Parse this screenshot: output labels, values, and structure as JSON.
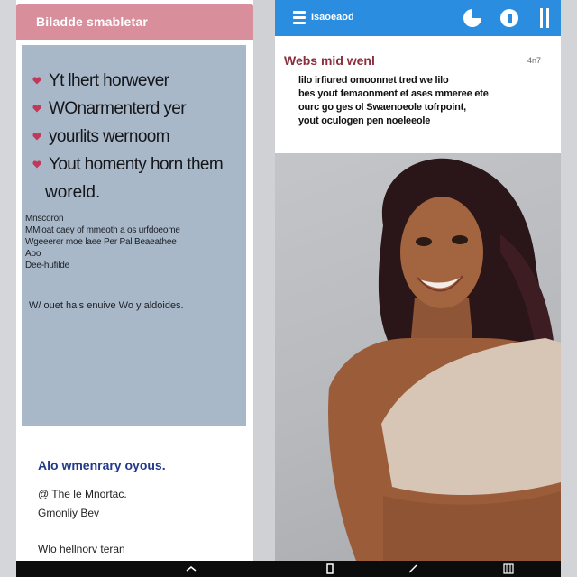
{
  "left": {
    "header_title": "Biladde smabletar",
    "bullets": [
      "Yt lhert horwever",
      "WOnarmenterd yer",
      "yourlits wernoom",
      "Yout homenty horn them"
    ],
    "bullet_continuation": "woreld.",
    "small_lines": [
      "Mnscoron",
      "MMloat caey of mmeoth a os urfdoeome",
      "Wgeeerer moe laee Per Pal Beaeathee",
      "Aoo",
      "Dee-hufilde"
    ],
    "card_footer": "W/ ouet hals enuive Wo y aldoides.",
    "blue_line": "Alo wmenrary oyous.",
    "list_items": [
      "@ The le Mnortac.",
      "Gmonliy Bev",
      "Wlo hellnorv teran"
    ]
  },
  "right": {
    "header_title": "Isaoeaod",
    "article_title": "Webs mid wenl",
    "article_meta": "4n7",
    "article_lines": [
      "lilo irfiured omoonnet tred we lilo",
      "bes yout femaonment et ases mmeree ete",
      "ourc go ges ol Swaenoeole tofrpoint,",
      "yout oculogen pen noeleeole"
    ]
  },
  "colors": {
    "left_header": "#d98e9c",
    "right_header": "#2a8de0",
    "card_bg": "#a9b8c8",
    "accent_blue_text": "#233a8a",
    "article_title": "#8a2d3e",
    "bullet_heart": "#c0395a"
  },
  "icons": {
    "menu": "menu-icon",
    "header_a": "pie-icon",
    "header_b": "circle-icon",
    "header_c": "pause-icon",
    "nav_back": "back-chevron-icon",
    "nav_home": "home-icon",
    "nav_recent": "recent-apps-icon"
  }
}
